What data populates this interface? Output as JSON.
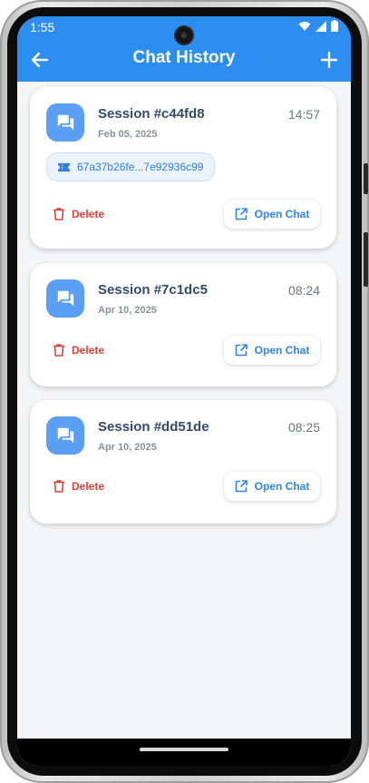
{
  "status_bar": {
    "time": "1:55"
  },
  "app_bar": {
    "title": "Chat History"
  },
  "sessions": [
    {
      "title": "Session #c44fd8",
      "date": "Feb 05, 2025",
      "time": "14:57",
      "chip": "67a37b26fe...7e92936c99",
      "delete_label": "Delete",
      "open_label": "Open Chat"
    },
    {
      "title": "Session #7c1dc5",
      "date": "Apr 10, 2025",
      "time": "08:24",
      "delete_label": "Delete",
      "open_label": "Open Chat"
    },
    {
      "title": "Session #dd51de",
      "date": "Apr 10, 2025",
      "time": "08:25",
      "delete_label": "Delete",
      "open_label": "Open Chat"
    }
  ],
  "colors": {
    "app_bar": "#2c8ef0",
    "card_icon": "#5b9ff5",
    "delete": "#e0403a",
    "open": "#2c86e8"
  },
  "icons": {
    "back": "arrow-back-icon",
    "add": "plus-icon",
    "card": "chat-bubbles-icon",
    "chip": "ticket-icon",
    "delete": "trash-icon",
    "open": "open-external-icon"
  }
}
